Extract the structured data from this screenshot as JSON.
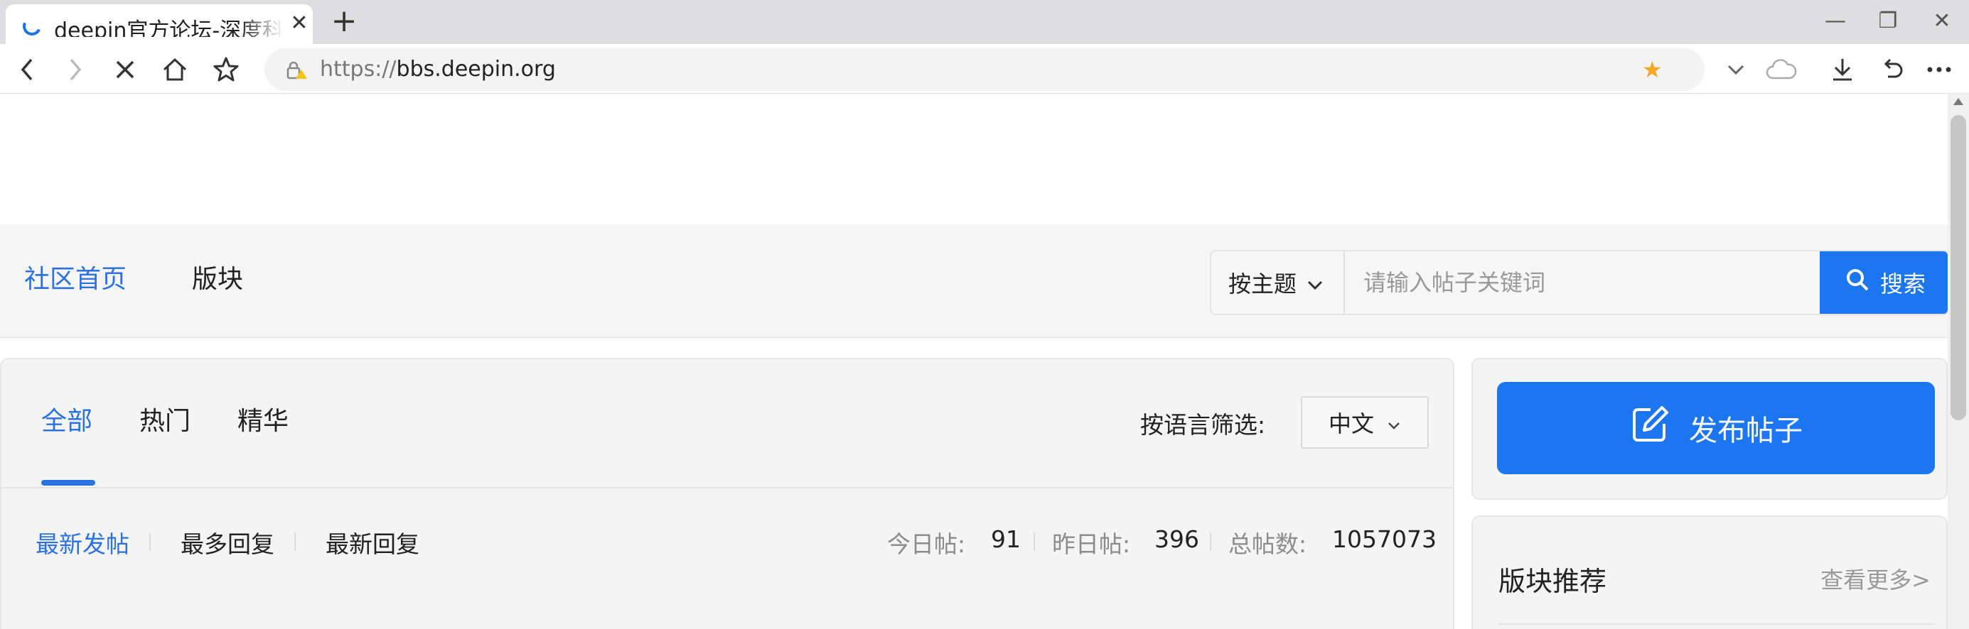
{
  "browser": {
    "tab_title": "deepin官方论坛-深度科技",
    "url_scheme": "https://",
    "url_host": "bbs.deepin.org",
    "icons": [
      "back-icon",
      "forward-icon",
      "stop-icon",
      "home-icon",
      "bookmark-icon",
      "star-filled-icon",
      "dropdown-icon",
      "cloud-icon",
      "download-icon",
      "undo-icon",
      "more-icon"
    ],
    "accent_color": "#f5a623"
  },
  "nav": {
    "home": "社区首页",
    "boards": "版块"
  },
  "search": {
    "type_label": "按主题",
    "placeholder": "请输入帖子关键词",
    "button_label": "搜索"
  },
  "tabs": [
    "全部",
    "热门",
    "精华"
  ],
  "language_filter": {
    "label": "按语言筛选:",
    "selected": "中文"
  },
  "sort": [
    "最新发帖",
    "最多回复",
    "最新回复"
  ],
  "stats": {
    "today_label": "今日帖:",
    "today_value": "91",
    "yesterday_label": "昨日帖:",
    "yesterday_value": "396",
    "total_label": "总帖数:",
    "total_value": "1057073"
  },
  "sidebar": {
    "publish_label": "发布帖子",
    "recommend_title": "版块推荐",
    "more_label": "查看更多>"
  },
  "colors": {
    "primary": "#1b76f0",
    "link": "#2b72e0",
    "muted": "#8c8c8c"
  }
}
